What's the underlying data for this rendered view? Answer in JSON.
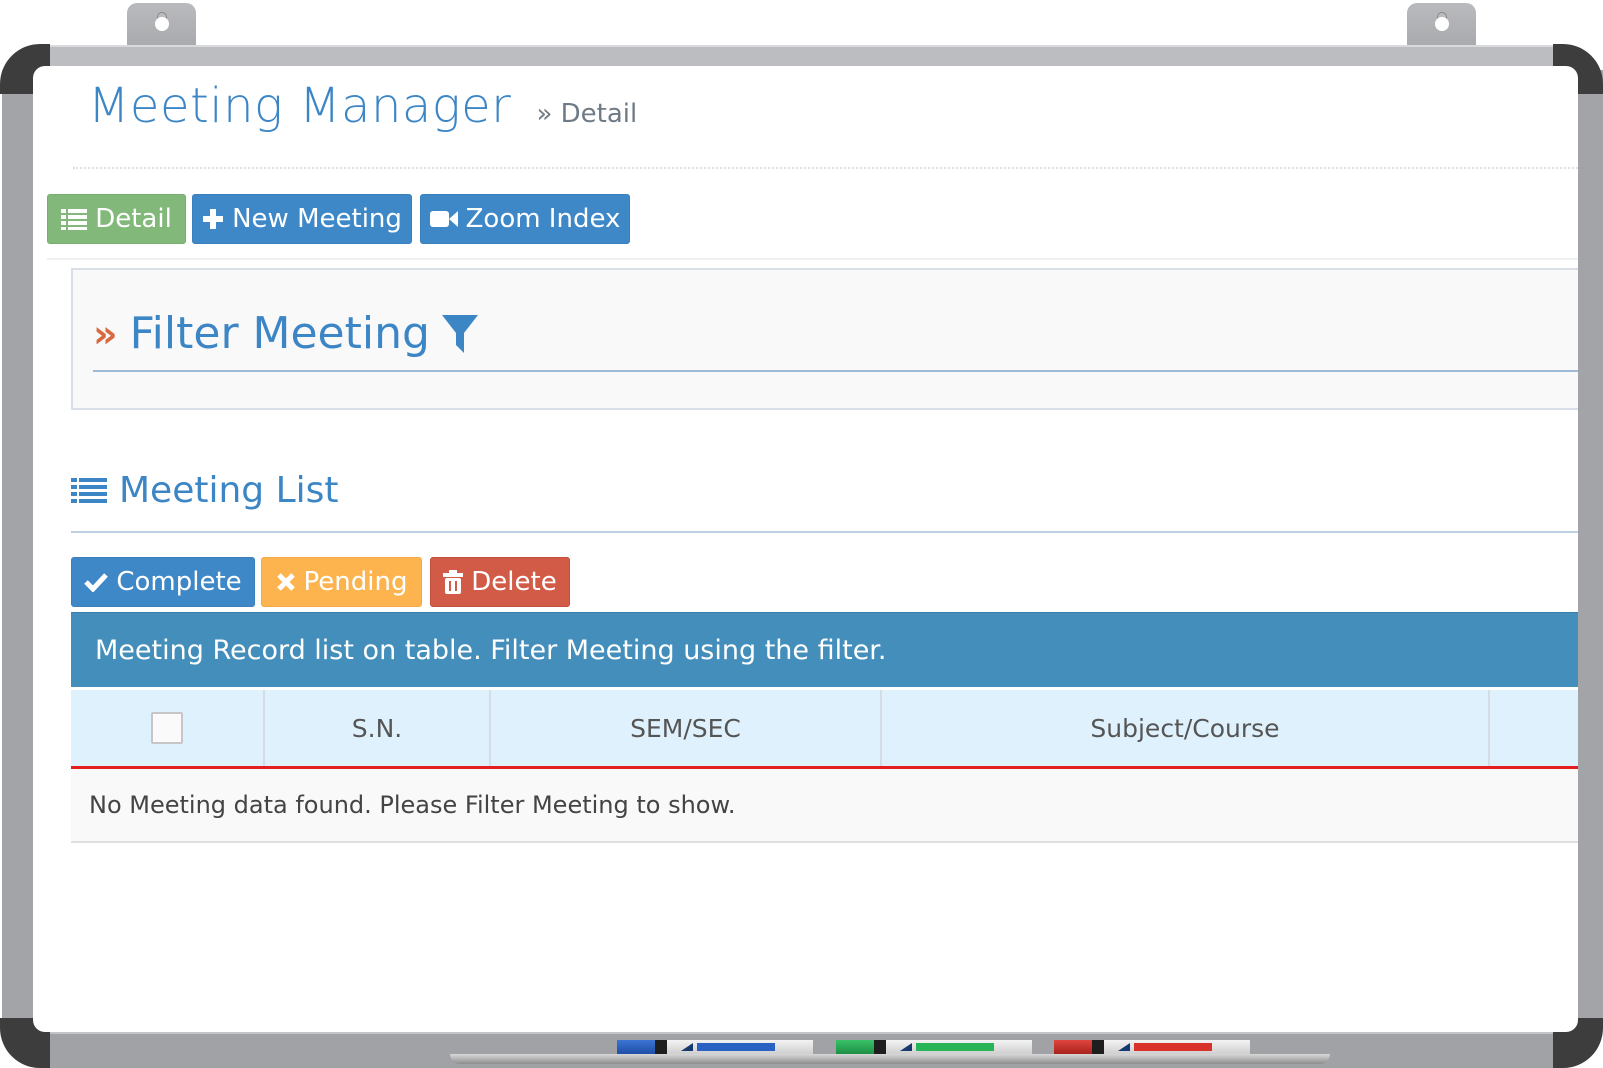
{
  "header": {
    "title": "Meeting Manager",
    "breadcrumb": "» Detail"
  },
  "toolbar": {
    "detail_label": "Detail",
    "new_meeting_label": "New Meeting",
    "zoom_index_label": "Zoom Index"
  },
  "filter": {
    "chevron": "»",
    "title": "Filter Meeting"
  },
  "list": {
    "title": "Meeting List",
    "actions": {
      "complete_label": "Complete",
      "pending_label": "Pending",
      "delete_label": "Delete"
    },
    "info_text": "Meeting Record list on table. Filter Meeting using the filter.",
    "columns": [
      "",
      "S.N.",
      "SEM/SEC",
      "Subject/Course",
      ""
    ],
    "empty_message": "No Meeting data found. Please Filter Meeting to show."
  },
  "icons": {
    "detail": "list-icon",
    "new_meeting": "plus-icon",
    "zoom_index": "video-camera-icon",
    "filter": "filter-funnel-icon",
    "list": "list-icon",
    "complete": "check-icon",
    "pending": "times-icon",
    "delete": "trash-icon"
  },
  "colors": {
    "title_blue": "#3d86c6",
    "success_green": "#82b879",
    "primary_blue": "#3f88c8",
    "warning_orange": "#fdb44e",
    "danger_red": "#d15b47",
    "info_bar": "#438eba",
    "table_header": "#dff1fd",
    "header_underline": "#e41e1e"
  },
  "markers": [
    {
      "name": "blue-marker",
      "color": "#2a62c4"
    },
    {
      "name": "green-marker",
      "color": "#27b456"
    },
    {
      "name": "red-marker",
      "color": "#d8322b"
    }
  ]
}
